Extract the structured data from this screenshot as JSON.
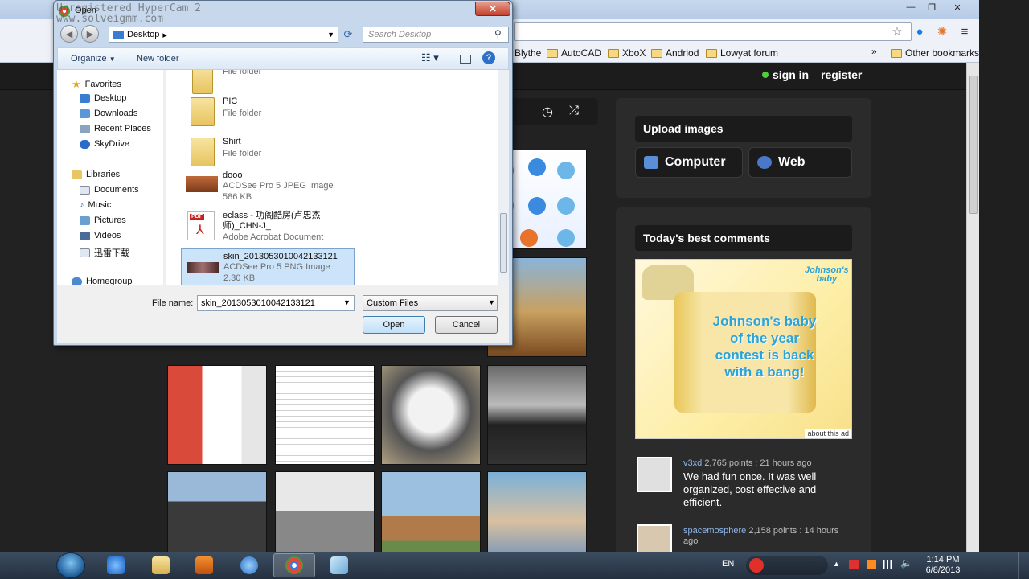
{
  "browser": {
    "bookmarks": [
      {
        "label": "Blythe",
        "folder": false
      },
      {
        "label": "AutoCAD",
        "folder": true
      },
      {
        "label": "XboX",
        "folder": true
      },
      {
        "label": "Andriod",
        "folder": true
      },
      {
        "label": "Lowyat forum",
        "folder": true
      }
    ],
    "other_bookmarks": "Other bookmarks",
    "chevron": "»",
    "window_controls": {
      "minimize": "—",
      "maximize": "❐",
      "close": "✕"
    }
  },
  "site": {
    "sign_in": "sign in",
    "register": "register",
    "upload_title": "Upload images",
    "upload_computer": "Computer",
    "upload_web": "Web",
    "comments_title": "Today's best comments",
    "ad": {
      "brand_line1": "Johnson's",
      "brand_line2": "baby",
      "text": "Johnson's baby of the year contest is back with a bang!",
      "about": "about this ad"
    },
    "comments": [
      {
        "user": "v3xd",
        "meta": "2,765 points : 21 hours ago",
        "body": "We had fun once. It was well organized, cost effective and efficient."
      },
      {
        "user": "spacemosphere",
        "meta": "2,158 points : 14 hours ago",
        "body": ""
      }
    ]
  },
  "dialog": {
    "title": "Open",
    "watermark_line1": "Unregistered HyperCam 2",
    "watermark_line2": "www.solveigmm.com",
    "close": "✕",
    "path": "Desktop",
    "search_placeholder": "Search Desktop",
    "organize": "Organize",
    "new_folder": "New folder",
    "nav": {
      "favorites": "Favorites",
      "fav_items": [
        "Desktop",
        "Downloads",
        "Recent Places",
        "SkyDrive"
      ],
      "libraries": "Libraries",
      "lib_items": [
        "Documents",
        "Music",
        "Pictures",
        "Videos",
        "迅雷下载"
      ],
      "homegroup": "Homegroup"
    },
    "files": [
      {
        "name": "",
        "type": "File folder",
        "size": ""
      },
      {
        "name": "PIC",
        "type": "File folder",
        "size": ""
      },
      {
        "name": "Shirt",
        "type": "File folder",
        "size": ""
      },
      {
        "name": "dooo",
        "type": "ACDSee Pro 5 JPEG Image",
        "size": "586 KB"
      },
      {
        "name": "eclass - 功阁酷房(卢忠杰师)_CHN-J_",
        "type": "Adobe Acrobat Document",
        "size": ""
      },
      {
        "name": "skin_20130530100421331 21",
        "type": "ACDSee Pro 5 PNG Image",
        "size": "2.30 KB"
      }
    ],
    "selected_file": "skin_2013053010042133121",
    "file_name_label": "File name:",
    "file_name_value": "skin_2013053010042133121",
    "file_type": "Custom Files",
    "open_button": "Open",
    "cancel_button": "Cancel",
    "pdf_badge": "PDF"
  },
  "taskbar": {
    "lang": "EN",
    "time": "1:14 PM",
    "date": "6/8/2013"
  },
  "colors": {
    "accent": "#3b7cd3",
    "site_bg": "#222222",
    "link": "#8fb7ea"
  }
}
